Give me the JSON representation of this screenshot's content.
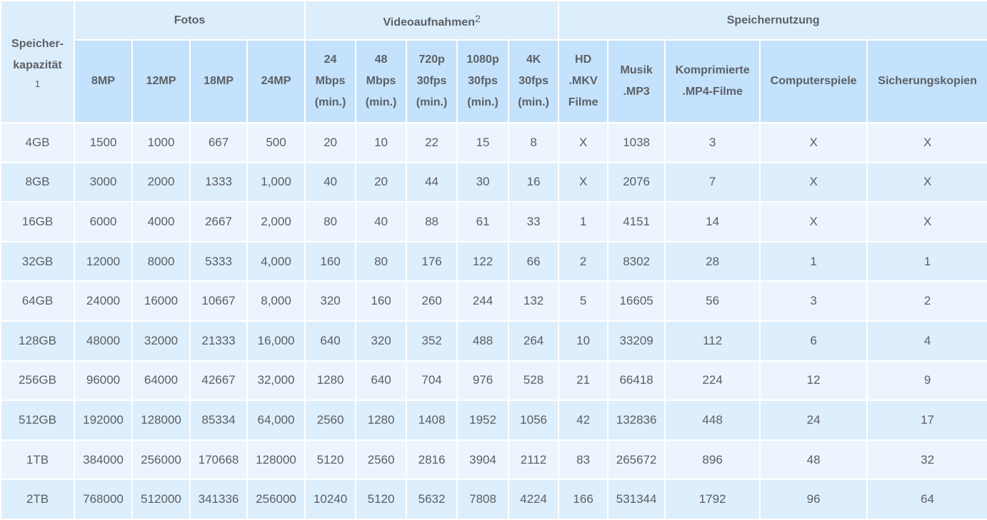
{
  "headers": {
    "capacity": "Speicher-kapazität",
    "capacity_note": "1",
    "group_photos": "Fotos",
    "group_video": "Videoaufnahmen",
    "group_video_note": "2",
    "group_storage": "Speichernutzung"
  },
  "columns": [
    "8MP",
    "12MP",
    "18MP",
    "24MP",
    "24 Mbps (min.)",
    "48 Mbps (min.)",
    "720p 30fps (min.)",
    "1080p 30fps (min.)",
    "4K 30fps (min.)",
    "HD .MKV Filme",
    "Musik .MP3",
    "Komprimierte .MP4-Filme",
    "Computerspiele",
    "Sicherungskopien"
  ],
  "rows": [
    [
      "4GB",
      "1500",
      "1000",
      "667",
      "500",
      "20",
      "10",
      "22",
      "15",
      "8",
      "X",
      "1038",
      "3",
      "X",
      "X"
    ],
    [
      "8GB",
      "3000",
      "2000",
      "1333",
      "1,000",
      "40",
      "20",
      "44",
      "30",
      "16",
      "X",
      "2076",
      "7",
      "X",
      "X"
    ],
    [
      "16GB",
      "6000",
      "4000",
      "2667",
      "2,000",
      "80",
      "40",
      "88",
      "61",
      "33",
      "1",
      "4151",
      "14",
      "X",
      "X"
    ],
    [
      "32GB",
      "12000",
      "8000",
      "5333",
      "4,000",
      "160",
      "80",
      "176",
      "122",
      "66",
      "2",
      "8302",
      "28",
      "1",
      "1"
    ],
    [
      "64GB",
      "24000",
      "16000",
      "10667",
      "8,000",
      "320",
      "160",
      "260",
      "244",
      "132",
      "5",
      "16605",
      "56",
      "3",
      "2"
    ],
    [
      "128GB",
      "48000",
      "32000",
      "21333",
      "16,000",
      "640",
      "320",
      "352",
      "488",
      "264",
      "10",
      "33209",
      "112",
      "6",
      "4"
    ],
    [
      "256GB",
      "96000",
      "64000",
      "42667",
      "32,000",
      "1280",
      "640",
      "704",
      "976",
      "528",
      "21",
      "66418",
      "224",
      "12",
      "9"
    ],
    [
      "512GB",
      "192000",
      "128000",
      "85334",
      "64,000",
      "2560",
      "1280",
      "1408",
      "1952",
      "1056",
      "42",
      "132836",
      "448",
      "24",
      "17"
    ],
    [
      "1TB",
      "384000",
      "256000",
      "170668",
      "128000",
      "5120",
      "2560",
      "2816",
      "3904",
      "2112",
      "83",
      "265672",
      "896",
      "48",
      "32"
    ],
    [
      "2TB",
      "768000",
      "512000",
      "341336",
      "256000",
      "10240",
      "5120",
      "5632",
      "7808",
      "4224",
      "166",
      "531344",
      "1792",
      "96",
      "64"
    ]
  ]
}
